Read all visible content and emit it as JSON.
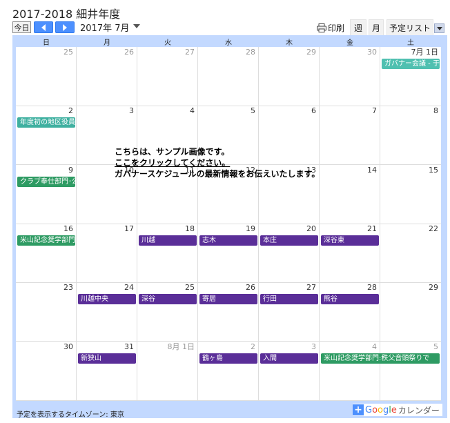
{
  "title": "2017-2018 細井年度",
  "toolbar": {
    "today_label": "今日",
    "month_label": "2017年 7月",
    "print_label": "印刷",
    "week_tab": "週",
    "month_tab": "月",
    "agenda_tab": "予定リスト"
  },
  "weekdays": [
    "日",
    "月",
    "火",
    "水",
    "木",
    "金",
    "土"
  ],
  "weeks": [
    {
      "days": [
        {
          "num": "25",
          "other": true
        },
        {
          "num": "26",
          "other": true
        },
        {
          "num": "27",
          "other": true
        },
        {
          "num": "28",
          "other": true
        },
        {
          "num": "29",
          "other": true
        },
        {
          "num": "30",
          "other": true
        },
        {
          "num": "7月 1日",
          "other": false
        }
      ]
    },
    {
      "days": [
        {
          "num": "2"
        },
        {
          "num": "3"
        },
        {
          "num": "4"
        },
        {
          "num": "5"
        },
        {
          "num": "6"
        },
        {
          "num": "7"
        },
        {
          "num": "8"
        }
      ]
    },
    {
      "days": [
        {
          "num": "9"
        },
        {
          "num": "10"
        },
        {
          "num": "11"
        },
        {
          "num": "12"
        },
        {
          "num": "13"
        },
        {
          "num": "14"
        },
        {
          "num": "15"
        }
      ]
    },
    {
      "days": [
        {
          "num": "16"
        },
        {
          "num": "17"
        },
        {
          "num": "18"
        },
        {
          "num": "19"
        },
        {
          "num": "20"
        },
        {
          "num": "21"
        },
        {
          "num": "22"
        }
      ]
    },
    {
      "days": [
        {
          "num": "23"
        },
        {
          "num": "24"
        },
        {
          "num": "25"
        },
        {
          "num": "26"
        },
        {
          "num": "27"
        },
        {
          "num": "28"
        },
        {
          "num": "29"
        }
      ]
    },
    {
      "days": [
        {
          "num": "30"
        },
        {
          "num": "31"
        },
        {
          "num": "8月 1日",
          "other": true
        },
        {
          "num": "2",
          "other": true
        },
        {
          "num": "3",
          "other": true
        },
        {
          "num": "4",
          "other": true
        },
        {
          "num": "5",
          "other": true
        }
      ]
    }
  ],
  "events": [
    {
      "week": 0,
      "start": 6,
      "span": 1,
      "label": "ガバナー会議 - 于",
      "color": "teal-light"
    },
    {
      "week": 1,
      "start": 0,
      "span": 1,
      "label": "年度初の地区役員",
      "color": "teal"
    },
    {
      "week": 2,
      "start": 0,
      "span": 1,
      "label": "クラブ奉仕部門･公",
      "color": "green"
    },
    {
      "week": 3,
      "start": 0,
      "span": 1,
      "label": "米山記念奨学部門",
      "color": "green"
    },
    {
      "week": 3,
      "start": 2,
      "span": 1,
      "label": "川越",
      "color": "purple"
    },
    {
      "week": 3,
      "start": 3,
      "span": 1,
      "label": "志木",
      "color": "purple"
    },
    {
      "week": 3,
      "start": 4,
      "span": 1,
      "label": "本庄",
      "color": "purple"
    },
    {
      "week": 3,
      "start": 5,
      "span": 1,
      "label": "深谷東",
      "color": "purple"
    },
    {
      "week": 4,
      "start": 1,
      "span": 1,
      "label": "川越中央",
      "color": "purple"
    },
    {
      "week": 4,
      "start": 2,
      "span": 1,
      "label": "深谷",
      "color": "purple"
    },
    {
      "week": 4,
      "start": 3,
      "span": 1,
      "label": "寄居",
      "color": "purple"
    },
    {
      "week": 4,
      "start": 4,
      "span": 1,
      "label": "行田",
      "color": "purple"
    },
    {
      "week": 4,
      "start": 5,
      "span": 1,
      "label": "熊谷",
      "color": "purple"
    },
    {
      "week": 5,
      "start": 1,
      "span": 1,
      "label": "新狭山",
      "color": "purple"
    },
    {
      "week": 5,
      "start": 3,
      "span": 1,
      "label": "鶴ヶ島",
      "color": "purple"
    },
    {
      "week": 5,
      "start": 4,
      "span": 1,
      "label": "入間",
      "color": "purple"
    },
    {
      "week": 5,
      "start": 5,
      "span": 2,
      "label": "米山記念奨学部門:秩父音頭祭りで",
      "color": "green"
    }
  ],
  "overlay": {
    "line1": "こちらは、サンプル画像です。",
    "line2": "ここをクリックしてください。",
    "line3": "ガバナースケジュールの最新情報をお伝えいたします。"
  },
  "footer": {
    "timezone": "予定を表示するタイムゾーン: 東京",
    "google_word": "Google",
    "calendar_word": "カレンダー"
  },
  "colors": {
    "teal": "#3fb0a0",
    "teal-light": "#4fc0b0",
    "green": "#2e9b63",
    "purple": "#5a2e98",
    "calendar_border": "#c3d9ff",
    "nav_button": "#4d90fe"
  }
}
